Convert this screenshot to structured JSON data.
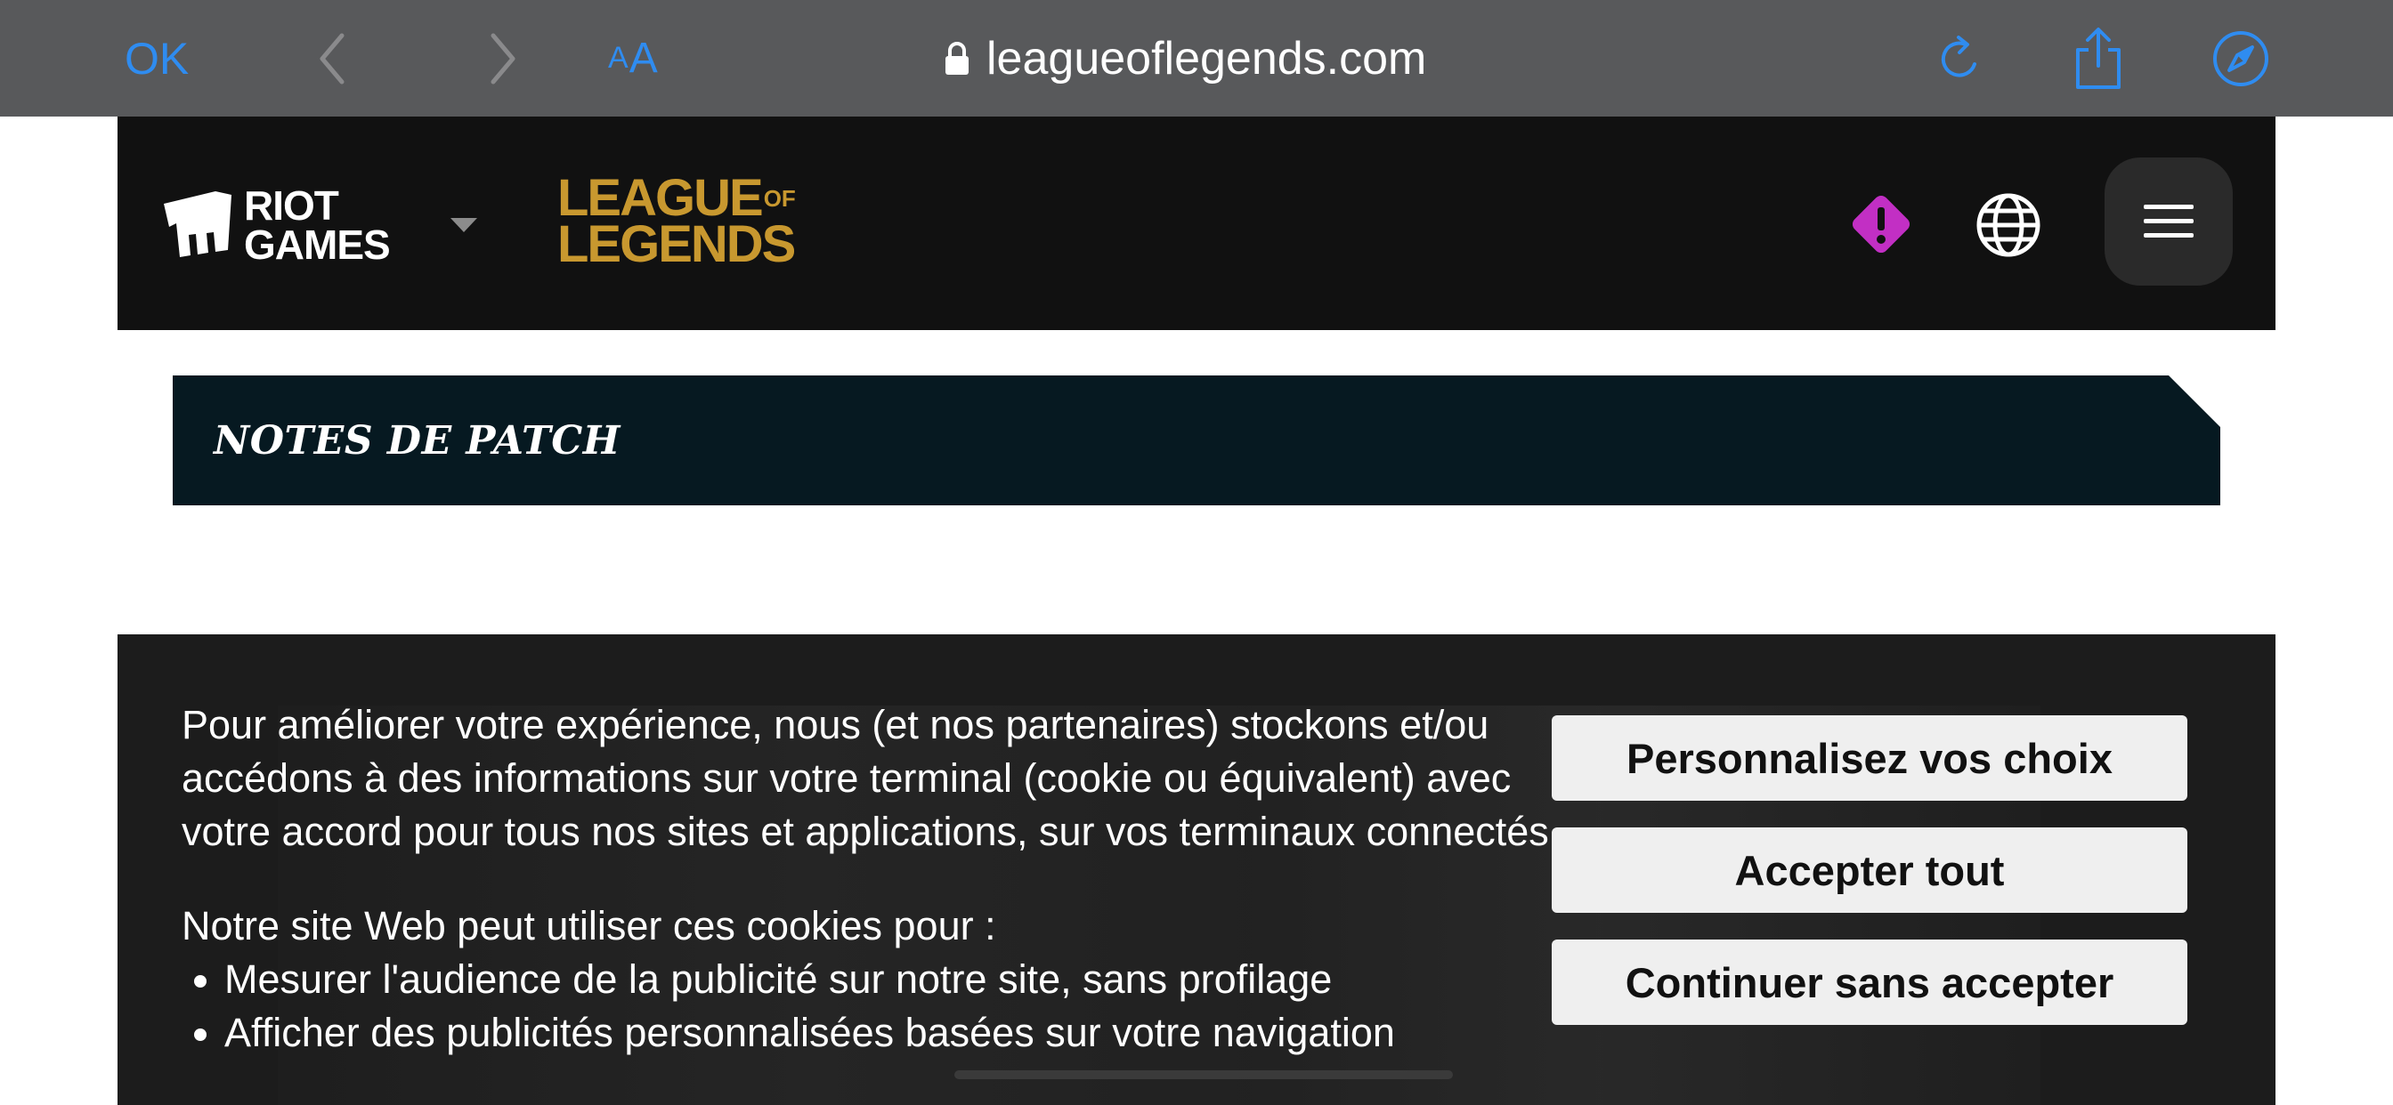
{
  "browser": {
    "done_label": "OK",
    "text_size_label_small": "A",
    "text_size_label_large": "A",
    "url": "leagueoflegends.com"
  },
  "site": {
    "riot_logo_line1": "RIOT",
    "riot_logo_line2": "GAMES",
    "lol_logo_line1": "LEAGUE",
    "lol_logo_of": "OF",
    "lol_logo_line2": "LEGENDS",
    "alert_color": "#c22fc4",
    "brand_gold": "#c8982f",
    "banner_title": "NOTES DE PATCH"
  },
  "consent": {
    "paragraph": "Pour améliorer votre expérience, nous (et nos partenaires) stockons et/ou accédons à des informations sur votre terminal (cookie ou équivalent) avec votre accord pour tous nos sites et applications, sur vos terminaux connectés.",
    "list_intro": "Notre site Web peut utiliser ces cookies pour :",
    "list_items": [
      "Mesurer l'audience de la publicité sur notre site, sans profilage",
      "Afficher des publicités personnalisées basées sur votre navigation"
    ],
    "buttons": {
      "customize": "Personnalisez vos choix",
      "accept_all": "Accepter tout",
      "continue_without": "Continuer sans accepter"
    }
  }
}
